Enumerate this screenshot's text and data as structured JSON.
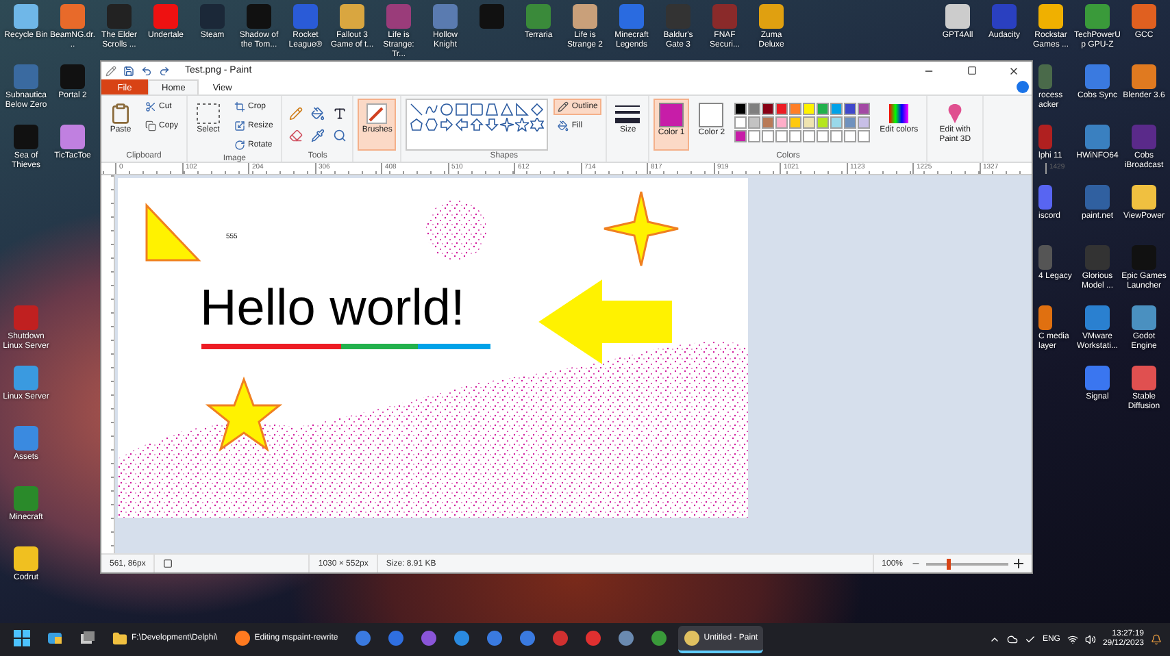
{
  "desktop": {
    "icons": [
      {
        "label": "Recycle Bin"
      },
      {
        "label": "BeamNG.dr..."
      },
      {
        "label": "The Elder Scrolls ..."
      },
      {
        "label": "Undertale"
      },
      {
        "label": "Steam"
      },
      {
        "label": "Shadow of the Tom..."
      },
      {
        "label": "Rocket League®"
      },
      {
        "label": "Fallout 3 Game of t..."
      },
      {
        "label": "Life is Strange: Tr..."
      },
      {
        "label": "Hollow Knight"
      },
      {
        "kind": "unlabeled"
      },
      {
        "label": "Terraria"
      },
      {
        "label": "Life is Strange 2"
      },
      {
        "label": "Minecraft Legends"
      },
      {
        "label": "Baldur's Gate 3"
      },
      {
        "label": "FNAF Securi..."
      },
      {
        "label": "Zuma Deluxe"
      },
      {
        "label": "GPT4All"
      },
      {
        "label": "Audacity"
      },
      {
        "label": "Rockstar Games ..."
      },
      {
        "label": "TechPowerUp GPU-Z"
      },
      {
        "label": "GCC"
      },
      {
        "label": "Subnautica Below Zero"
      },
      {
        "label": "Portal 2"
      },
      {
        "label": "rocess acker",
        "kind": "partial"
      },
      {
        "label": "Cobs Sync"
      },
      {
        "label": "Blender 3.6"
      },
      {
        "label": "Sea of Thieves"
      },
      {
        "label": "TicTacToe"
      },
      {
        "label": "lphi 11",
        "kind": "partial"
      },
      {
        "label": "HWiNFO64"
      },
      {
        "label": "Cobs iBroadcast"
      },
      {
        "label": "iscord",
        "kind": "partial"
      },
      {
        "label": "paint.net"
      },
      {
        "label": "ViewPower"
      },
      {
        "label": "4 Legacy",
        "kind": "partial"
      },
      {
        "label": "Glorious Model ..."
      },
      {
        "label": "Epic Games Launcher"
      },
      {
        "label": "Shutdown Linux Server"
      },
      {
        "label": "C media layer",
        "kind": "partial"
      },
      {
        "label": "VMware Workstati..."
      },
      {
        "label": "Godot Engine"
      },
      {
        "label": "Linux Server"
      },
      {
        "label": "Signal"
      },
      {
        "label": "Stable Diffusion"
      },
      {
        "label": "Assets"
      },
      {
        "label": "Minecraft"
      },
      {
        "label": "Codrut"
      }
    ]
  },
  "paint": {
    "title": "Test.png - Paint",
    "tabs": [
      {
        "label": "File",
        "kind": "file",
        "selected": false
      },
      {
        "label": "Home",
        "kind": "tab",
        "selected": true
      },
      {
        "label": "View",
        "kind": "tab",
        "selected": false
      }
    ],
    "clipboard": {
      "paste": "Paste",
      "cut": "Cut",
      "copy": "Copy",
      "group": "Clipboard"
    },
    "image": {
      "select": "Select",
      "crop": "Crop",
      "resize": "Resize",
      "rotate": "Rotate",
      "group": "Image"
    },
    "tools": {
      "group": "Tools"
    },
    "brushes": {
      "label": "Brushes",
      "selected": true
    },
    "shapes": {
      "group": "Shapes",
      "outline": {
        "label": "Outline",
        "selected": true
      },
      "fill": {
        "label": "Fill",
        "selected": false
      }
    },
    "size": {
      "label": "Size"
    },
    "color1": {
      "label": "Color 1",
      "color": "#c71da8",
      "selected": true
    },
    "color2": {
      "label": "Color 2",
      "color": "#ffffff",
      "selected": false
    },
    "palette": [
      {
        "color": "#000000"
      },
      {
        "color": "#7f7f7f"
      },
      {
        "color": "#880015"
      },
      {
        "color": "#ed1c24"
      },
      {
        "color": "#ff7f27"
      },
      {
        "color": "#fff200"
      },
      {
        "color": "#22b14c"
      },
      {
        "color": "#00a2e8"
      },
      {
        "color": "#3f48cc"
      },
      {
        "color": "#a349a4"
      },
      {
        "color": "#ffffff"
      },
      {
        "color": "#c3c3c3"
      },
      {
        "color": "#b97a57"
      },
      {
        "color": "#ffaec9"
      },
      {
        "color": "#ffc90e"
      },
      {
        "color": "#efe4b0"
      },
      {
        "color": "#b5e61d"
      },
      {
        "color": "#99d9ea"
      },
      {
        "color": "#7092be"
      },
      {
        "color": "#c8bfe7"
      },
      {
        "color": "#c71da8"
      },
      {
        "color": "#ffffff"
      },
      {
        "color": "#ffffff"
      },
      {
        "color": "#ffffff"
      },
      {
        "color": "#ffffff"
      },
      {
        "color": "#ffffff"
      },
      {
        "color": "#ffffff"
      },
      {
        "color": "#ffffff"
      },
      {
        "color": "#ffffff"
      },
      {
        "color": "#ffffff"
      }
    ],
    "colors_group": "Colors",
    "edit_colors": "Edit colors",
    "paint3d": "Edit with Paint 3D",
    "ruler": [
      "0",
      "102",
      "204",
      "306",
      "408",
      "510",
      "612",
      "714",
      "817",
      "919",
      "1021",
      "1123",
      "1225",
      "1327",
      "1429"
    ],
    "canvas": {
      "small_text": "555",
      "heading": "Hello world!"
    },
    "status": {
      "cursor": "561, 86px",
      "dimensions": "1030 × 552px",
      "file_size": "Size: 8.91 KB",
      "zoom": "100%",
      "zoom_slider": {
        "level": 0.25
      }
    }
  },
  "taskbar": {
    "items": [
      {
        "kind": "start"
      },
      {
        "kind": "widgets"
      },
      {
        "kind": "taskview"
      },
      {
        "kind": "folder",
        "label": "F:\\Development\\Delphi\\",
        "selected": false
      },
      {
        "kind": "browser",
        "label": "Editing mspaint-rewrite",
        "selected": false
      },
      {
        "kind": "app",
        "selected": false
      },
      {
        "kind": "todo",
        "selected": false
      },
      {
        "kind": "vs",
        "selected": false
      },
      {
        "kind": "vscode",
        "selected": false
      },
      {
        "kind": "app",
        "selected": false
      },
      {
        "kind": "app",
        "selected": false
      },
      {
        "kind": "delphi",
        "selected": false
      },
      {
        "kind": "popcorn",
        "selected": false
      },
      {
        "kind": "steam",
        "selected": false
      },
      {
        "kind": "minecraft",
        "selected": false
      },
      {
        "kind": "paint",
        "label": "Untitled - Paint",
        "selected": true
      }
    ],
    "language": "ENG",
    "time": "13:27:19",
    "date": "29/12/2023"
  }
}
